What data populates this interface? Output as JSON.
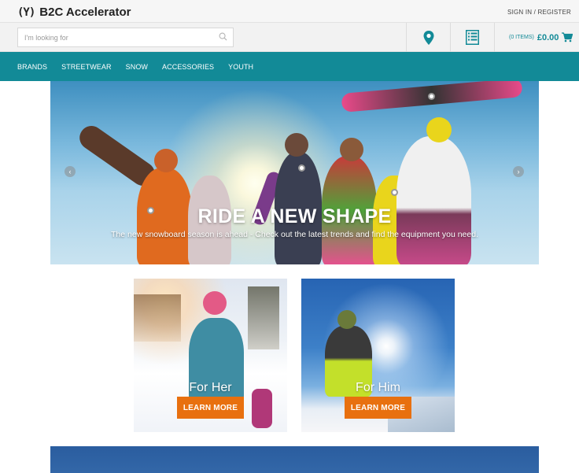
{
  "header": {
    "logo_mark": "(Y)",
    "logo_text": "B2C Accelerator",
    "signin_label": "SIGN IN / REGISTER"
  },
  "search": {
    "placeholder": "I'm looking for",
    "value": ""
  },
  "utility": {
    "store_locator_icon": "map-pin-icon",
    "quick_order_icon": "list-icon",
    "cart_items": "(0 ITEMS)",
    "cart_total": "£0.00",
    "cart_icon": "cart-icon"
  },
  "nav": {
    "items": [
      "BRANDS",
      "STREETWEAR",
      "SNOW",
      "ACCESSORIES",
      "YOUTH"
    ]
  },
  "hero": {
    "title": "RIDE A NEW SHAPE",
    "subtitle": "The new snowboard season is ahead - Check out the latest trends and find the equipment you need.",
    "prev_icon": "chevron-left-icon",
    "next_icon": "chevron-right-icon"
  },
  "tiles": [
    {
      "label": "For Her",
      "button": "LEARN MORE"
    },
    {
      "label": "For Him",
      "button": "LEARN MORE"
    }
  ],
  "colors": {
    "teal": "#128a97",
    "orange": "#e8700f",
    "banner_blue": "#2a5d9f"
  }
}
